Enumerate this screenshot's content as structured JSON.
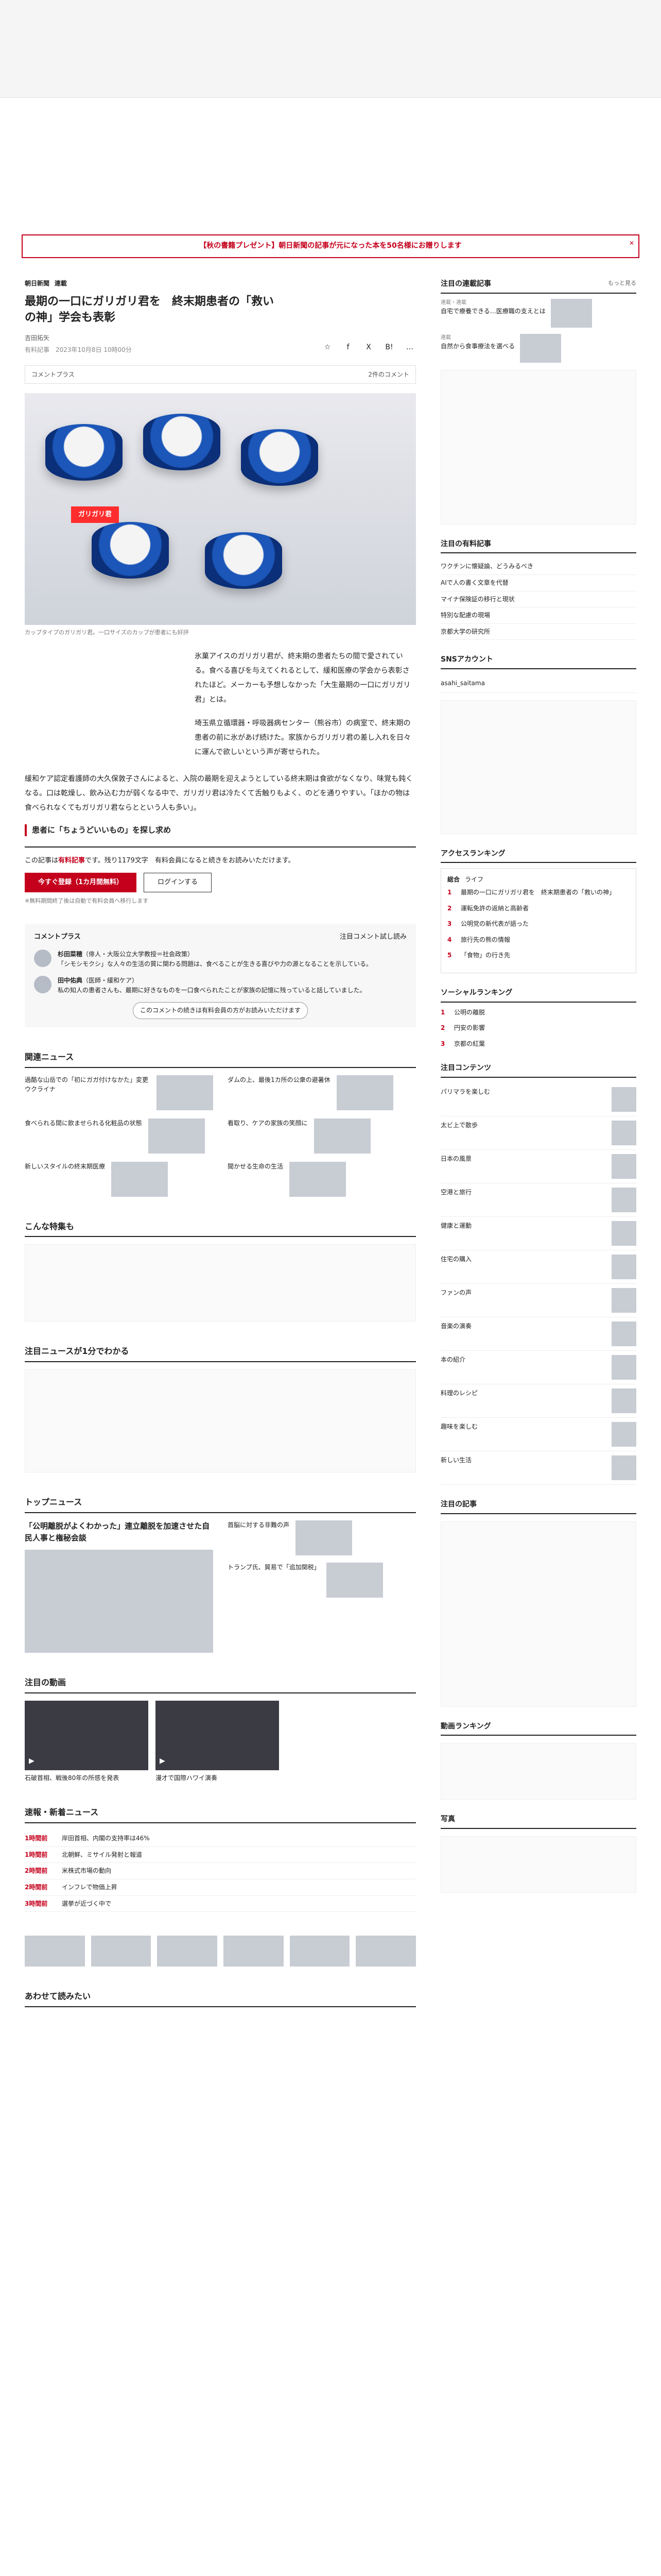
{
  "banner": "【秋の書籍プレゼント】朝日新聞の記事が元になった本を50名様にお贈りします",
  "breadcrumb": [
    "朝日新聞",
    "連載"
  ],
  "article": {
    "title": "最期の一口にガリガリ君を　終末期患者の「救いの神」学会も表彰",
    "author": "吉田拓矢",
    "date": "有料記事　2023年10月8日 10時00分",
    "comment_plus": "コメントプラス",
    "comment_count": "2件のコメント",
    "photo_label": "ガリガリ君",
    "caption": "カップタイプのガリガリ君。一口サイズのカップが患者にも好評",
    "para1": "氷菓アイスのガリガリ君が、終末期の患者たちの間で愛されている。食べる喜びを与えてくれるとして、緩和医療の学会から表彰されたほど。メーカーも予想しなかった「大生最期の一口にガリガリ君」とは。",
    "para2": "埼玉県立循環器・呼吸器病センター（熊谷市）の病室で、終末期の患者の前に氷があげ続けた。家族からガリガリ君の差し入れを日々に運んで欲しいという声が寄せられた。",
    "para3": "緩和ケア認定看護師の大久保敦子さんによると、入院の最期を迎えようとしている終末期は食欲がなくなり、味覚も鈍くなる。口は乾燥し、飲み込む力が弱くなる中で、ガリガリ君は冷たくて舌触りもよく、のどを通りやすい。「ほかの物は食べられなくてもガリガリ君ならとという人も多い」。",
    "subhead": "患者に「ちょうどいいもの」を探し求め",
    "pay_msg_pre": "この記事は",
    "pay_msg_red": "有料記事",
    "pay_msg_post": "です。残り1179文字　有料会員になると続きをお読みいただけます。",
    "btn_sub": "今すぐ登録（1カ月間無料）",
    "btn_login": "ログインする",
    "note": "※無料期間終了後は自動で有料会員へ移行します"
  },
  "comments": {
    "heading": "コメントプラス",
    "more": "注目コメント試し読み",
    "items": [
      {
        "name": "杉田菜穂",
        "role": "（俳人・大阪公立大学教授＝社会政策）",
        "text": "「シモシモクシ」な人々の生活の質に関わる問題は、食べることが生きる喜びや力の源となることを示している。"
      },
      {
        "name": "田中佑典",
        "role": "（医師・緩和ケア）",
        "text": "私の知人の患者さんも、最期に好きなものを一口食べられたことが家族の記憶に残っていると話していました。"
      }
    ],
    "more_btn": "このコメントの続きは有料会員の方がお読みいただけます"
  },
  "related": {
    "heading": "関連ニュース",
    "items": [
      "過酷な山岳での「初にガガ付けなかた」変更ウクライナ",
      "ダムの上、最後1カ所の公衆の避暑休",
      "食べられる間に飲ませられる化粧品の状態",
      "看取り、ケアの家族の笑顔に",
      "新しいスタイルの終末期医療",
      "聞かせる生命の生活"
    ]
  },
  "popular": {
    "heading": "こんな特集も"
  },
  "topics_heading": "注目ニュースが1分でわかる",
  "topnews": {
    "heading": "トップニュース",
    "items": [
      "「公明離脱がよくわかった」連立離脱を加速させた自民人事と権秘会談",
      "首脳に対する非難の声",
      "トランプ氏、貿易で「追加関税」"
    ]
  },
  "videos": {
    "heading": "注目の動画",
    "items": [
      "石破首相、戦後80年の所感を発表",
      "漫才で国際ハワイ演奏"
    ]
  },
  "breaking": {
    "heading": "速報・新着ニュース",
    "items": [
      {
        "time": "1時間前",
        "text": "岸田首相、内閣の支持率は46%"
      },
      {
        "time": "1時間前",
        "text": "北朝鮮、ミサイル発射と報道"
      },
      {
        "time": "2時間前",
        "text": "米株式市場の動向"
      },
      {
        "time": "2時間前",
        "text": "インフレで物価上昇"
      },
      {
        "time": "3時間前",
        "text": "選挙が近づく中で"
      }
    ]
  },
  "sidebar": {
    "notable_heading": "注目の連載記事",
    "notable_more": "もっと見る",
    "notable": [
      {
        "tag": "連載・連載",
        "text": "自宅で療養できる…医療職の支えとは"
      },
      {
        "tag": "連載",
        "text": "自然から食事療法を選べる"
      }
    ],
    "premium_heading": "注目の有料記事",
    "premium": [
      "ワクチンに懐疑論、どうみるべき",
      "AIで人の書く文章を代替",
      "マイナ保険証の移行と現状",
      "特別な配慮の現場",
      "京都大学の研究所"
    ],
    "access_heading": "アクセスランキング",
    "access_tabs": [
      "総合",
      "ライフ"
    ],
    "access": [
      "最期の一口にガリガリ君を　終末期患者の「救いの神」",
      "運転免許の返納と高齢者",
      "公明党の新代表が語った",
      "旅行先の熊の情報",
      "「食物」の行き先"
    ],
    "social_heading": "ソーシャルランキング",
    "social": [
      "公明の離脱",
      "円安の影響",
      "京都の紅葉"
    ],
    "contents_heading": "注目コンテンツ",
    "contents": [
      "パリマラを楽しむ",
      "太ビ上で散歩",
      "日本の風景",
      "空港と旅行",
      "健康と運動",
      "住宅の購入",
      "ファンの声",
      "音楽の演奏",
      "本の紹介",
      "料理のレシピ",
      "趣味を楽しむ",
      "新しい生活"
    ],
    "promo_heading": "注目の記事",
    "video_rank_heading": "動画ランキング",
    "photo_heading": "写真",
    "sns_heading": "SNSアカウント",
    "sns_name": "asahi_saitama"
  },
  "footer_heading": "あわせて読みたい"
}
